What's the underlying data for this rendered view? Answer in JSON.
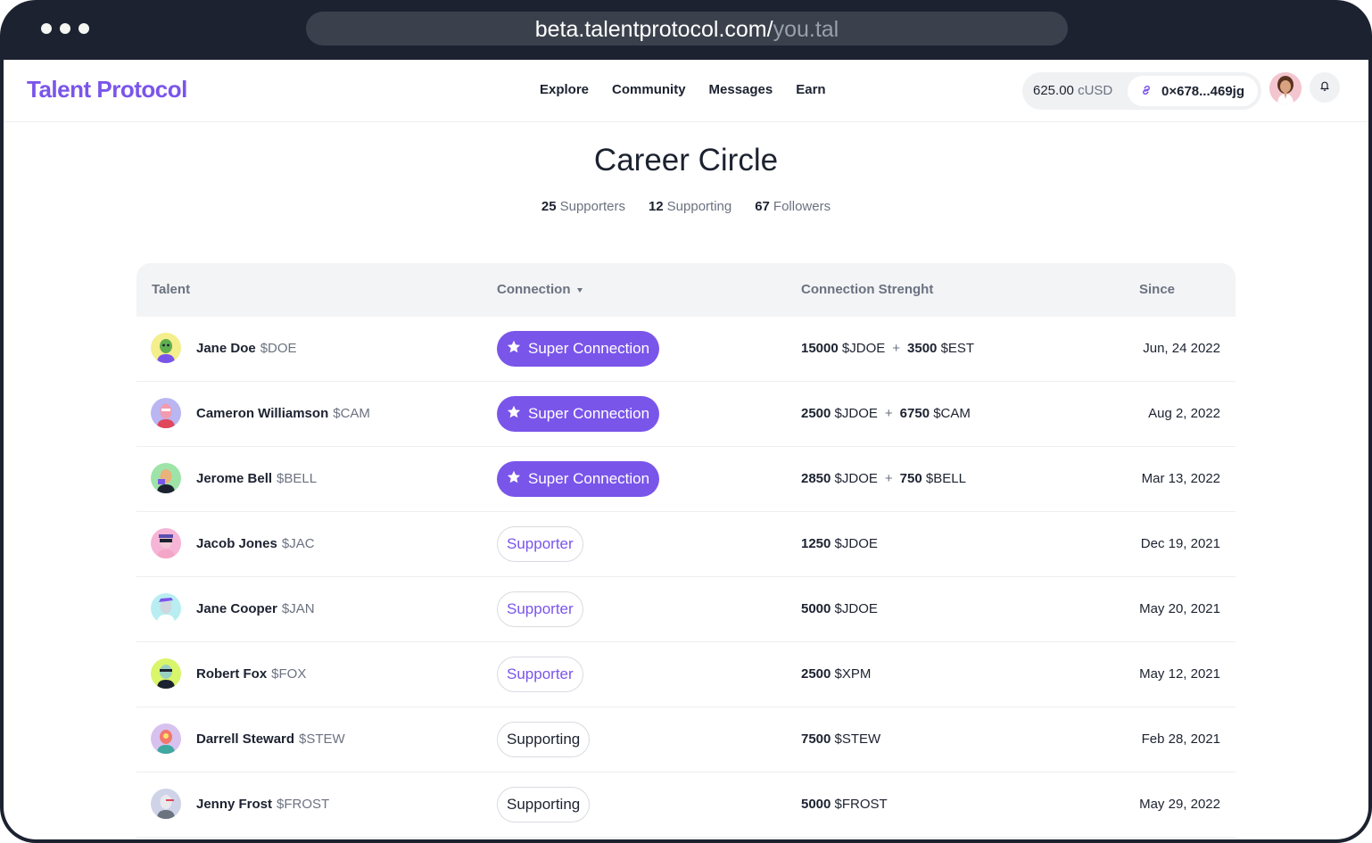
{
  "browser": {
    "url_domain": "beta.talentprotocol.com/",
    "url_path": "you.tal"
  },
  "header": {
    "logo": "Talent Protocol",
    "nav": [
      "Explore",
      "Community",
      "Messages",
      "Earn"
    ],
    "balance_value": "625.00",
    "balance_unit": "cUSD",
    "wallet_address": "0×678...469jg",
    "icons": [
      "link-icon",
      "bell-icon"
    ]
  },
  "page": {
    "title": "Career Circle",
    "stats": [
      {
        "count": "25",
        "label": "Supporters"
      },
      {
        "count": "12",
        "label": "Supporting"
      },
      {
        "count": "67",
        "label": "Followers"
      }
    ]
  },
  "table": {
    "columns": [
      "Talent",
      "Connection",
      "Connection Strenght",
      "Since"
    ],
    "rows": [
      {
        "name": "Jane Doe",
        "token": "$DOE",
        "connection": "Super Connection",
        "kind": "super",
        "amount1": "15000",
        "token1": "$JDOE",
        "amount2": "3500",
        "token2": "$EST",
        "since": "Jun, 24 2022"
      },
      {
        "name": "Cameron Williamson",
        "token": "$CAM",
        "connection": "Super Connection",
        "kind": "super",
        "amount1": "2500",
        "token1": "$JDOE",
        "amount2": "6750",
        "token2": "$CAM",
        "since": "Aug 2, 2022"
      },
      {
        "name": "Jerome Bell",
        "token": "$BELL",
        "connection": "Super Connection",
        "kind": "super",
        "amount1": "2850",
        "token1": "$JDOE",
        "amount2": "750",
        "token2": "$BELL",
        "since": "Mar 13, 2022"
      },
      {
        "name": "Jacob Jones",
        "token": "$JAC",
        "connection": "Supporter",
        "kind": "supporter",
        "amount1": "1250",
        "token1": "$JDOE",
        "since": "Dec 19, 2021"
      },
      {
        "name": "Jane Cooper",
        "token": "$JAN",
        "connection": "Supporter",
        "kind": "supporter",
        "amount1": "5000",
        "token1": "$JDOE",
        "since": "May 20, 2021"
      },
      {
        "name": "Robert Fox",
        "token": "$FOX",
        "connection": "Supporter",
        "kind": "supporter",
        "amount1": "2500",
        "token1": "$XPM",
        "since": "May 12, 2021"
      },
      {
        "name": "Darrell Steward",
        "token": "$STEW",
        "connection": "Supporting",
        "kind": "supporting",
        "amount1": "7500",
        "token1": "$STEW",
        "since": "Feb 28, 2021"
      },
      {
        "name": "Jenny Frost",
        "token": "$FROST",
        "connection": "Supporting",
        "kind": "supporting",
        "amount1": "5000",
        "token1": "$FROST",
        "since": "May 29, 2022"
      }
    ]
  },
  "colors": {
    "brand": "#7a55ea",
    "frame": "#1c2230",
    "avatar_backgrounds": [
      "#f4ee8c",
      "#b9b6f2",
      "#9ee3a8",
      "#f6b5d6",
      "#b8eef1",
      "#d9f56a",
      "#d7c2ef",
      "#cfd3e8"
    ]
  }
}
